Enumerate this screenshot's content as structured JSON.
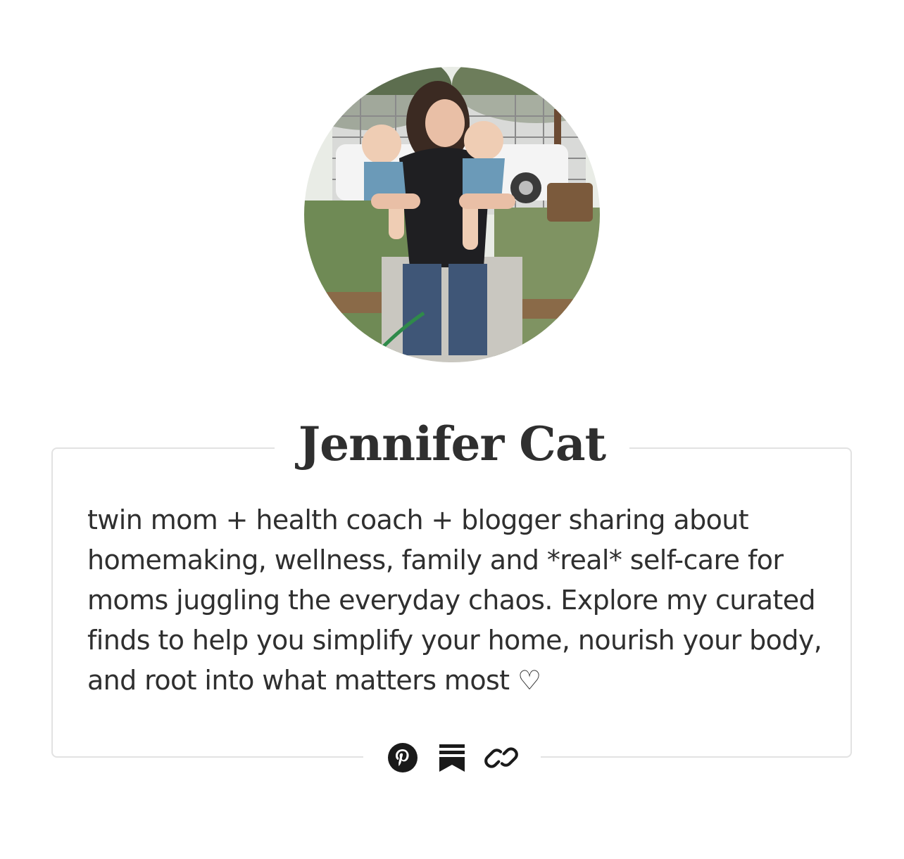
{
  "profile": {
    "name": "Jennifer Cat",
    "bio": "twin mom + health coach + blogger sharing about homemaking, wellness, family and *real* self-care for moms juggling the everyday chaos. Explore my curated finds to help you simplify your home, nourish your body, and root into what matters most ♡",
    "avatar_icon": "profile-photo"
  },
  "socials": [
    {
      "icon": "pinterest-icon"
    },
    {
      "icon": "substack-icon"
    },
    {
      "icon": "link-icon"
    }
  ],
  "colors": {
    "text": "#2f2f2f",
    "border": "#e2e2e2",
    "icon": "#1a1a1a",
    "background": "#ffffff"
  }
}
